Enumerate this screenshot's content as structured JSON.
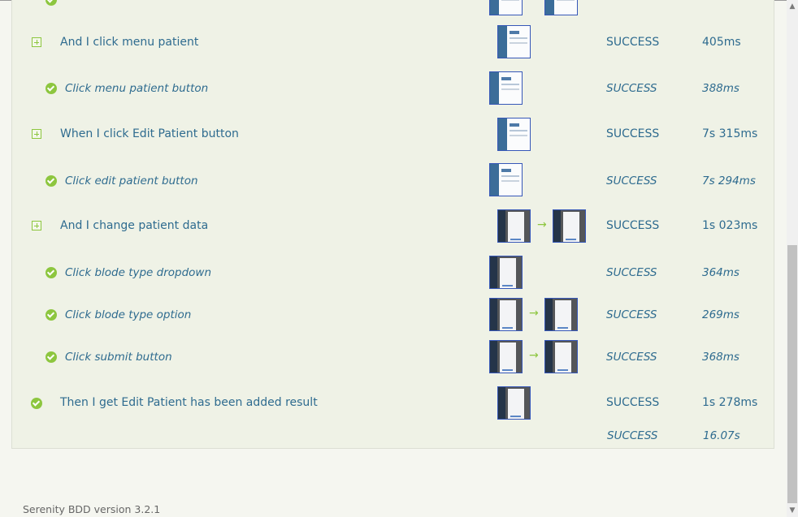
{
  "steps": [
    {
      "label": "",
      "status": "",
      "time": "",
      "type": "sub"
    },
    {
      "label": "And I click menu patient",
      "status": "SUCCESS",
      "time": "405ms",
      "type": "main"
    },
    {
      "label": "Click menu patient button",
      "status": "SUCCESS",
      "time": "388ms",
      "type": "sub"
    },
    {
      "label": "When I click Edit Patient button",
      "status": "SUCCESS",
      "time": "7s 315ms",
      "type": "main"
    },
    {
      "label": "Click edit patient button",
      "status": "SUCCESS",
      "time": "7s 294ms",
      "type": "sub"
    },
    {
      "label": "And I change patient data",
      "status": "SUCCESS",
      "time": "1s 023ms",
      "type": "main"
    },
    {
      "label": "Click blode type dropdown",
      "status": "SUCCESS",
      "time": "364ms",
      "type": "sub"
    },
    {
      "label": "Click blode type option",
      "status": "SUCCESS",
      "time": "269ms",
      "type": "sub"
    },
    {
      "label": "Click submit button",
      "status": "SUCCESS",
      "time": "368ms",
      "type": "sub"
    },
    {
      "label": "Then I get Edit Patient has been added result",
      "status": "SUCCESS",
      "time": "1s 278ms",
      "type": "main-check"
    }
  ],
  "summary": {
    "status": "SUCCESS",
    "time": "16.07s"
  },
  "arrow_glyph": "→",
  "footer": {
    "text": "Serenity BDD version 3.2.1"
  },
  "colors": {
    "accent": "#8dc63f",
    "text": "#2e6b8f",
    "panel": "#eff2e6"
  }
}
